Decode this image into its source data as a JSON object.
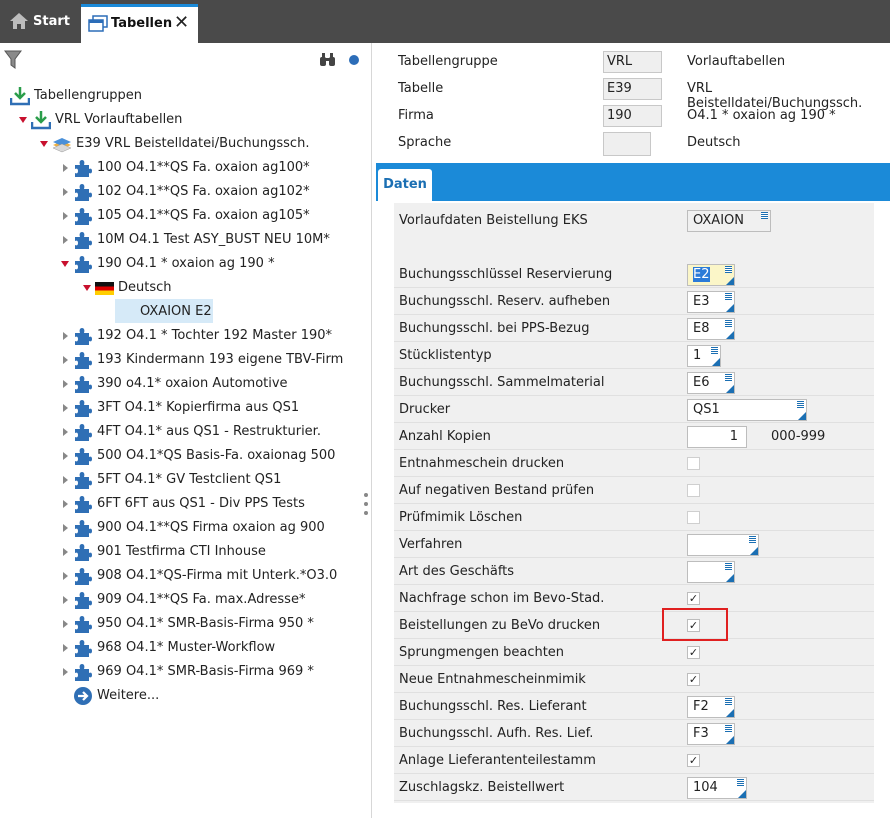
{
  "tabs": {
    "start_label": "Start",
    "active_label": "Tabellen"
  },
  "tree": {
    "root_label": "Tabellengruppen",
    "group_label": "VRL  Vorlauftabellen",
    "table_label": "E39  VRL Beistelldatei/Buchungssch.",
    "firms_before": [
      "100 O4.1**QS Fa. oxaion ag100*",
      "102 O4.1**QS Fa. oxaion ag102*",
      "105 O4.1**QS Fa. oxaion ag105*",
      "10M O4.1 Test ASY_BUST NEU    10M*"
    ],
    "expanded_firm": "190 O4.1 * oxaion ag 190    *",
    "language_label": "Deutsch",
    "selected_entry": "OXAION  E2",
    "firms_after": [
      "192 O4.1 * Tochter 192 Master 190*",
      "193 Kindermann 193 eigene TBV-Firm",
      "390 o4.1* oxaion Automotive",
      "3FT O4.1* Kopierfirma aus  QS1",
      "4FT O4.1* aus QS1 - Restrukturier.",
      "500 O4.1*QS Basis-Fa. oxaionag 500",
      "5FT O4.1* GV Testclient QS1",
      "6FT 6FT aus QS1 - Div PPS Tests",
      "900 O4.1**QS Firma oxaion ag 900",
      "901 Testfirma CTI Inhouse",
      "908 O4.1*QS-Firma mit Unterk.*O3.0",
      "909 O4.1**QS Fa. max.Adresse*",
      "950 O4.1* SMR-Basis-Firma 950      *",
      "968 O4.1* Muster-Workflow",
      "969 O4.1* SMR-Basis-Firma 969      *"
    ],
    "more_label": "Weitere..."
  },
  "header": {
    "rows": [
      {
        "label": "Tabellengruppe",
        "code": "VRL",
        "desc": "Vorlauftabellen"
      },
      {
        "label": "Tabelle",
        "code": "E39",
        "desc": "VRL Beistelldatei/Buchungssch."
      },
      {
        "label": "Firma",
        "code": "190",
        "desc": "O4.1 * oxaion ag 190     *"
      },
      {
        "label": "Sprache",
        "code": "",
        "desc": "Deutsch"
      }
    ]
  },
  "daten_tab_label": "Daten",
  "form": {
    "vorlauf_label": "Vorlaufdaten Beistellung EKS",
    "vorlauf_value": "OXAION",
    "fields": [
      {
        "label": "Buchungsschlüssel Reservierung",
        "value": "E2"
      },
      {
        "label": "Buchungsschl. Reserv. aufheben",
        "value": "E3"
      },
      {
        "label": "Buchungsschl. bei PPS-Bezug",
        "value": "E8"
      },
      {
        "label": "Stücklistentyp",
        "value": "1"
      },
      {
        "label": "Buchungsschl. Sammelmaterial",
        "value": "E6"
      },
      {
        "label": "Drucker",
        "value": "QS1"
      },
      {
        "label": "Anzahl Kopien",
        "value": "1",
        "range": "000-999"
      },
      {
        "label": "Entnahmeschein drucken",
        "checked": false
      },
      {
        "label": "Auf negativen Bestand prüfen",
        "checked": false
      },
      {
        "label": "Prüfmimik Löschen",
        "checked": false
      },
      {
        "label": "Verfahren",
        "value": ""
      },
      {
        "label": "Art des Geschäfts",
        "value": ""
      },
      {
        "label": "Nachfrage schon im Bevo-Stad.",
        "checked": true
      },
      {
        "label": "Beistellungen zu BeVo drucken",
        "checked": true
      },
      {
        "label": "Sprungmengen beachten",
        "checked": true
      },
      {
        "label": "Neue Entnahmescheinmimik",
        "checked": true
      },
      {
        "label": "Buchungsschl. Res. Lieferant",
        "value": "F2"
      },
      {
        "label": "Buchungsschl. Aufh. Res. Lief.",
        "value": "F3"
      },
      {
        "label": "Anlage Lieferantenteilestamm",
        "checked": true
      },
      {
        "label": "Zuschlagskz. Beistellwert",
        "value": "104"
      }
    ]
  },
  "colors": {
    "accent": "#1b8ad8",
    "tabbar": "#4a4a4a",
    "highlight_box": "#e02020",
    "selected_row": "#d6eaf8"
  }
}
